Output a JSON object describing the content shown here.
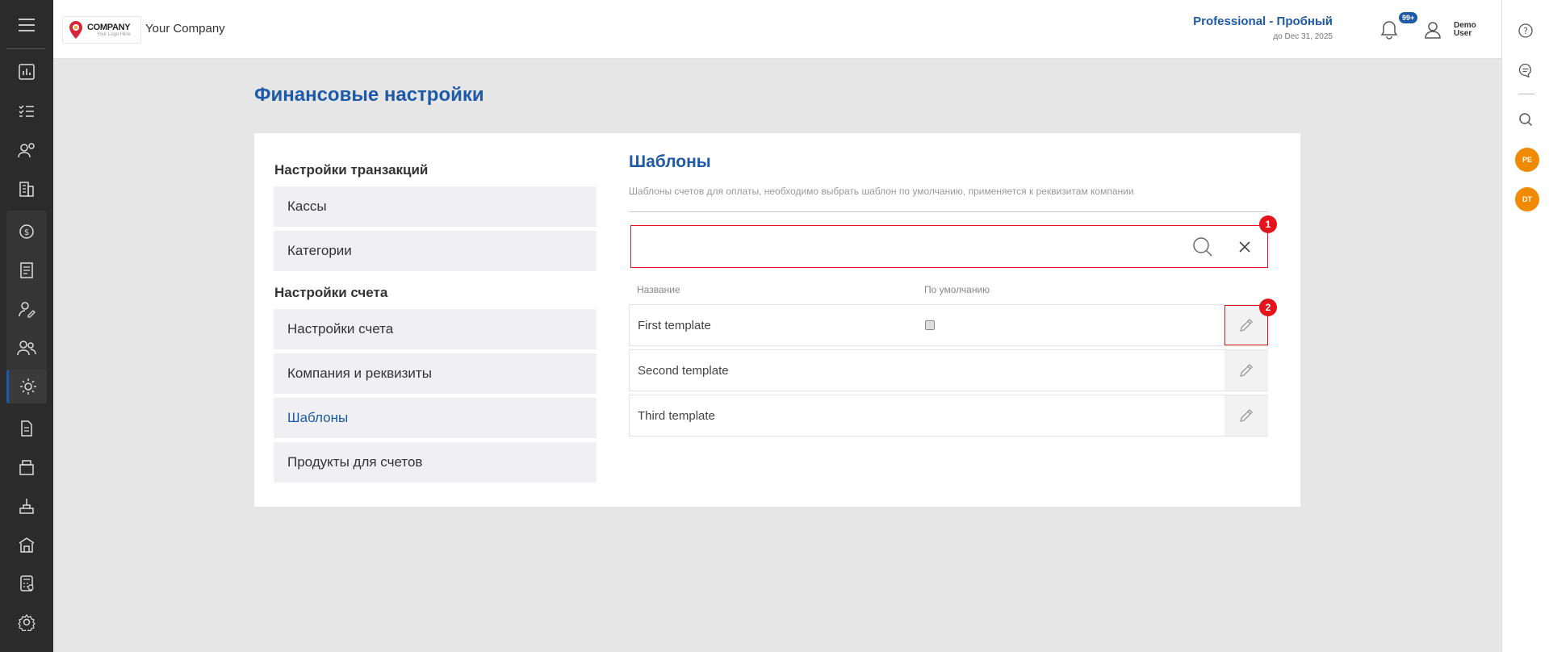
{
  "sidebar": {
    "icons": [
      "menu-icon",
      "dashboard-icon",
      "tasks-icon",
      "contacts-icon",
      "companies-icon",
      "finance-icon",
      "invoices-icon",
      "user-edit-icon",
      "team-icon",
      "finance-settings-icon",
      "documents-icon",
      "products-icon",
      "manufacturing-icon",
      "warehouse-icon",
      "calculator-icon",
      "settings-icon"
    ]
  },
  "header": {
    "logo_title": "COMPANY",
    "logo_sub": "Your Logo Here",
    "company_name": "Your Company",
    "plan_name": "Professional - Пробный",
    "plan_date": "до Dec 31, 2025",
    "notifications_badge": "99+",
    "user_first": "Demo",
    "user_last": "User"
  },
  "rightbar": {
    "avatars": [
      "PE",
      "DT"
    ]
  },
  "page": {
    "title": "Финансовые настройки"
  },
  "menu": {
    "section1": "Настройки транзакций",
    "items1": [
      "Кассы",
      "Категории"
    ],
    "section2": "Настройки счета",
    "items2": [
      "Настройки счета",
      "Компания и реквизиты",
      "Шаблоны",
      "Продукты для счетов"
    ],
    "active": "Шаблоны"
  },
  "templates": {
    "title": "Шаблоны",
    "description": "Шаблоны счетов для оплаты, необходимо выбрать шаблон по умолчанию, применяется к реквизитам компании",
    "search_value": "",
    "col_name": "Название",
    "col_default": "По умолчанию",
    "rows": [
      {
        "name": "First template",
        "has_checkbox": true,
        "default": false
      },
      {
        "name": "Second template",
        "has_checkbox": false
      },
      {
        "name": "Third template",
        "has_checkbox": false
      }
    ]
  },
  "annotations": {
    "marker1": "1",
    "marker2": "2"
  },
  "colors": {
    "accent": "#1e5aa8",
    "sidebar_bg": "#2b2b2b",
    "highlight": "#e3141b",
    "avatar": "#f08a00"
  }
}
